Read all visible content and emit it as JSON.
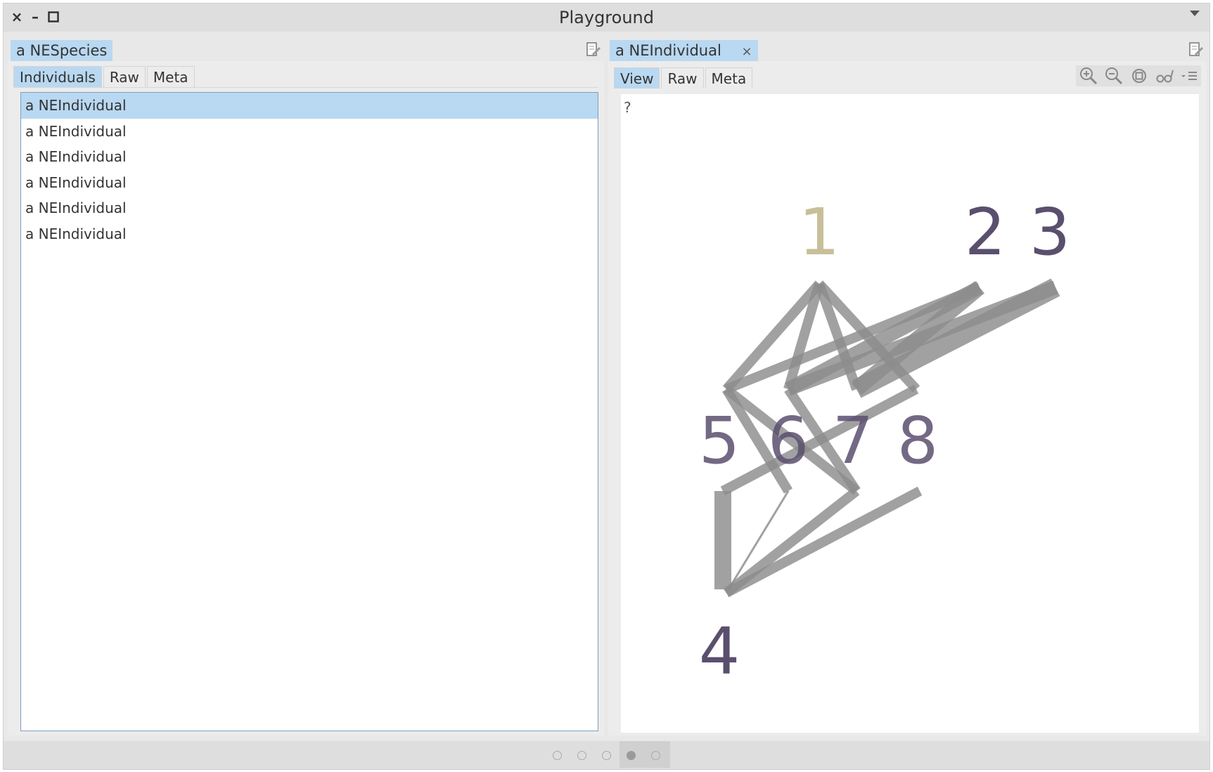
{
  "window": {
    "title": "Playground"
  },
  "left_pane": {
    "tab_label": "a NESpecies",
    "subtabs": [
      "Individuals",
      "Raw",
      "Meta"
    ],
    "active_subtab": "Individuals",
    "items": [
      "a NEIndividual",
      "a NEIndividual",
      "a NEIndividual",
      "a NEIndividual",
      "a NEIndividual",
      "a NEIndividual"
    ],
    "selected_index": 0
  },
  "right_pane": {
    "tab_label": "a NEIndividual",
    "tab_close": "×",
    "subtabs": [
      "View",
      "Raw",
      "Meta"
    ],
    "active_subtab": "View",
    "toolbar_icons": [
      "zoom-in-icon",
      "zoom-out-icon",
      "fit-icon",
      "glasses-icon",
      "menu-icon"
    ],
    "view": {
      "marker": "?",
      "nodes": [
        "1",
        "2",
        "3",
        "4",
        "5",
        "6",
        "7",
        "8"
      ],
      "highlighted_node": "1",
      "colors": {
        "node": "#5b4f6e",
        "highlight": "#c8bf9a",
        "edge": "#8c8c8c"
      }
    }
  },
  "status": {
    "pages": 5,
    "active_page": 4
  }
}
